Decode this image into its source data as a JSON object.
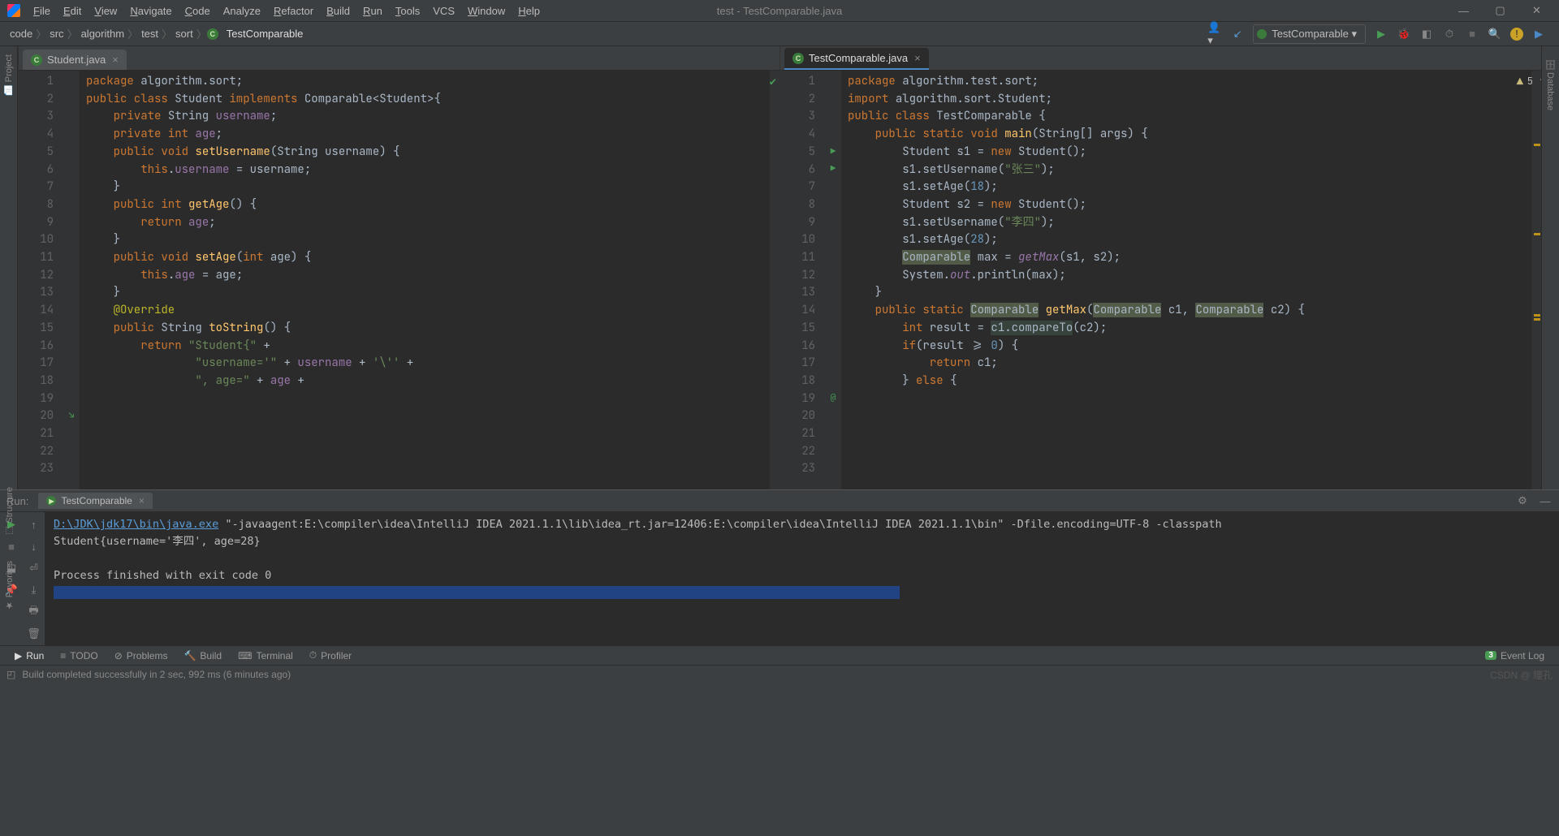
{
  "window": {
    "title": "test - TestComparable.java"
  },
  "menu": [
    "File",
    "Edit",
    "View",
    "Navigate",
    "Code",
    "Analyze",
    "Refactor",
    "Build",
    "Run",
    "Tools",
    "VCS",
    "Window",
    "Help"
  ],
  "menu_underline": [
    "F",
    "E",
    "V",
    "N",
    "C",
    "",
    "R",
    "B",
    "R",
    "T",
    "",
    "W",
    "H"
  ],
  "breadcrumbs": [
    "code",
    "src",
    "algorithm",
    "test",
    "sort",
    "TestComparable"
  ],
  "runConfig": "TestComparable",
  "sideLeft": [
    "Project"
  ],
  "sideLeft2": [
    "Structure",
    "Favorites"
  ],
  "sideRight": [
    "Database"
  ],
  "leftEditor": {
    "tab": "Student.java",
    "lines": 23,
    "warnings": {
      "count": 5
    },
    "code": [
      [
        [
          "kw",
          "package "
        ],
        [
          "",
          "algorithm.sort;"
        ]
      ],
      [
        [
          "",
          ""
        ]
      ],
      [
        [
          "kw",
          "public class "
        ],
        [
          "",
          "Student "
        ],
        [
          "kw",
          "implements "
        ],
        [
          "",
          "Comparable<Student>{"
        ]
      ],
      [
        [
          "",
          "    "
        ],
        [
          "kw",
          "private "
        ],
        [
          "",
          "String "
        ],
        [
          "fld",
          "username"
        ],
        [
          "",
          ";"
        ]
      ],
      [
        [
          "",
          "    "
        ],
        [
          "kw",
          "private int "
        ],
        [
          "fld",
          "age"
        ],
        [
          "",
          ";"
        ]
      ],
      [
        [
          "",
          ""
        ]
      ],
      [
        [
          "",
          "    "
        ],
        [
          "kw",
          "public void "
        ],
        [
          "fn",
          "setUsername"
        ],
        [
          "",
          "(String username) {"
        ]
      ],
      [
        [
          "",
          "        "
        ],
        [
          "kw",
          "this"
        ],
        [
          "",
          "."
        ],
        [
          "fld",
          "username"
        ],
        [
          "",
          ""
        ],
        [
          "",
          ""
        ],
        [
          "",
          ""
        ],
        [
          "",
          ""
        ],
        [
          "",
          " = username;"
        ]
      ],
      [
        [
          "",
          "    }"
        ]
      ],
      [
        [
          "",
          ""
        ]
      ],
      [
        [
          "",
          "    "
        ],
        [
          "kw",
          "public int "
        ],
        [
          "fn",
          "getAge"
        ],
        [
          "",
          "() {"
        ]
      ],
      [
        [
          "",
          "        "
        ],
        [
          "kw",
          "return "
        ],
        [
          "fld",
          "age"
        ],
        [
          "",
          ";"
        ]
      ],
      [
        [
          "",
          "    }"
        ]
      ],
      [
        [
          "",
          ""
        ]
      ],
      [
        [
          "",
          "    "
        ],
        [
          "kw",
          "public void "
        ],
        [
          "fn",
          "setAge"
        ],
        [
          "",
          "("
        ],
        [
          "kw",
          "int "
        ],
        [
          "",
          "age) {"
        ]
      ],
      [
        [
          "",
          "        "
        ],
        [
          "kw",
          "this"
        ],
        [
          "",
          "."
        ],
        [
          "fld",
          "age"
        ],
        [
          "",
          ""
        ],
        [
          "",
          " = age;"
        ]
      ],
      [
        [
          "",
          "    }"
        ]
      ],
      [
        [
          "",
          ""
        ]
      ],
      [
        [
          "",
          "    "
        ],
        [
          "ann",
          "@Override"
        ]
      ],
      [
        [
          "",
          "    "
        ],
        [
          "kw",
          "public "
        ],
        [
          "",
          "String "
        ],
        [
          "fn",
          "toString"
        ],
        [
          "",
          "() {"
        ]
      ],
      [
        [
          "",
          "        "
        ],
        [
          "kw",
          "return "
        ],
        [
          "str",
          "\"Student{\" "
        ],
        [
          "",
          "+"
        ]
      ],
      [
        [
          "",
          "                "
        ],
        [
          "str",
          "\"username='\" "
        ],
        [
          "",
          "+ "
        ],
        [
          "fld",
          "username"
        ],
        [
          "",
          ""
        ],
        [
          "",
          " + "
        ],
        [
          "str",
          "'\\'' "
        ],
        [
          "",
          "+"
        ]
      ],
      [
        [
          "",
          "                "
        ],
        [
          "str",
          "\", age=\" "
        ],
        [
          "",
          "+ "
        ],
        [
          "fld",
          "age"
        ],
        [
          "",
          ""
        ],
        [
          "",
          " +"
        ]
      ]
    ]
  },
  "rightEditor": {
    "tab": "TestComparable.java",
    "lines": 23,
    "warnings": 5,
    "code": [
      [
        [
          "kw",
          "package "
        ],
        [
          "",
          "algorithm.test.sort;"
        ]
      ],
      [
        [
          "",
          ""
        ]
      ],
      [
        [
          "kw",
          "import "
        ],
        [
          "",
          "algorithm.sort.Student;"
        ]
      ],
      [
        [
          "",
          ""
        ]
      ],
      [
        [
          "kw",
          "public class "
        ],
        [
          "",
          "TestComparable {"
        ]
      ],
      [
        [
          "",
          "    "
        ],
        [
          "kw",
          "public static void "
        ],
        [
          "fn",
          "main"
        ],
        [
          "",
          "(String[] args) {"
        ]
      ],
      [
        [
          "",
          "        Student s1 = "
        ],
        [
          "kw",
          "new "
        ],
        [
          "",
          "Student();"
        ]
      ],
      [
        [
          "",
          "        s1.setUsername("
        ],
        [
          "str",
          "\"张三\""
        ],
        [
          "",
          ");"
        ]
      ],
      [
        [
          "",
          "        s1.setAge("
        ],
        [
          "num",
          "18"
        ],
        [
          "",
          ");"
        ]
      ],
      [
        [
          "",
          ""
        ]
      ],
      [
        [
          "",
          "        Student s2 = "
        ],
        [
          "kw",
          "new "
        ],
        [
          "",
          "Student();"
        ]
      ],
      [
        [
          "",
          "        s1.setUsername("
        ],
        [
          "str",
          "\"李四\""
        ],
        [
          "",
          ");"
        ]
      ],
      [
        [
          "",
          "        s1.setAge("
        ],
        [
          "num",
          "28"
        ],
        [
          "",
          ");"
        ]
      ],
      [
        [
          "",
          ""
        ]
      ],
      [
        [
          "",
          "        "
        ],
        [
          "hl-box",
          "Comparable"
        ],
        [
          "",
          " max = "
        ],
        [
          "st",
          "getMax"
        ],
        [
          "",
          "(s1, s2);"
        ]
      ],
      [
        [
          "",
          "        System."
        ],
        [
          "st",
          "out"
        ],
        [
          "",
          ".println(max);"
        ]
      ],
      [
        [
          "",
          "    }"
        ]
      ],
      [
        [
          "",
          ""
        ]
      ],
      [
        [
          "",
          "    "
        ],
        [
          "kw",
          "public static "
        ],
        [
          "hl-box",
          "Comparable"
        ],
        [
          "",
          " "
        ],
        [
          "fn",
          "getMax"
        ],
        [
          "",
          "("
        ],
        [
          "hl-box",
          "Comparable"
        ],
        [
          "",
          " c1, "
        ],
        [
          "hl-box",
          "Comparable"
        ],
        [
          "",
          " c2) {"
        ]
      ],
      [
        [
          "",
          "        "
        ],
        [
          "kw",
          "int "
        ],
        [
          "",
          "result = "
        ],
        [
          "hl",
          "c1.compareTo"
        ],
        [
          "",
          "(c2);"
        ]
      ],
      [
        [
          "",
          "        "
        ],
        [
          "kw",
          "if"
        ],
        [
          "",
          "(result >= "
        ],
        [
          "num",
          "0"
        ],
        [
          "",
          ") {"
        ]
      ],
      [
        [
          "",
          "            "
        ],
        [
          "kw",
          "return "
        ],
        [
          "",
          "c1;"
        ]
      ],
      [
        [
          "",
          "        } "
        ],
        [
          "kw",
          "else "
        ],
        [
          "",
          "{"
        ]
      ]
    ]
  },
  "run": {
    "title": "Run:",
    "tab": "TestComparable",
    "jdkPath": "D:\\JDK\\jdk17\\bin\\java.exe",
    "args": " \"-javaagent:E:\\compiler\\idea\\IntelliJ IDEA 2021.1.1\\lib\\idea_rt.jar=12406:E:\\compiler\\idea\\IntelliJ IDEA 2021.1.1\\bin\" -Dfile.encoding=UTF-8 -classpath ",
    "out1": "Student{username='李四', age=28}",
    "exit": "Process finished with exit code 0"
  },
  "bottom": {
    "run": "Run",
    "todo": "TODO",
    "problems": "Problems",
    "build": "Build",
    "terminal": "Terminal",
    "profiler": "Profiler",
    "event": "Event Log",
    "eventCount": "3"
  },
  "status": {
    "msg": "Build completed successfully in 2 sec, 992 ms (6 minutes ago)",
    "watermark": "CSDN @ 瞳孔"
  }
}
